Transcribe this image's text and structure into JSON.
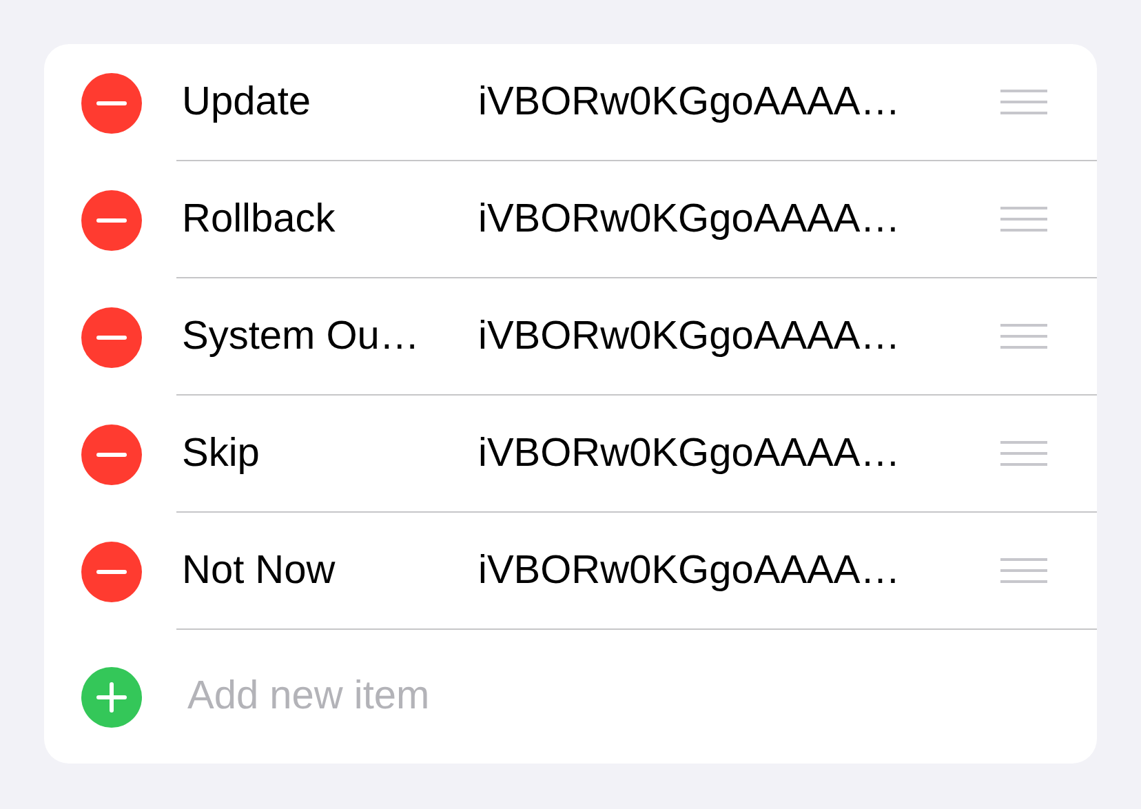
{
  "items": [
    {
      "label": "Update",
      "value": "iVBORw0KGgoAAAA…"
    },
    {
      "label": "Rollback",
      "value": "iVBORw0KGgoAAAA…"
    },
    {
      "label": "System Ou…",
      "value": "iVBORw0KGgoAAAA…"
    },
    {
      "label": "Skip",
      "value": "iVBORw0KGgoAAAA…"
    },
    {
      "label": "Not Now",
      "value": "iVBORw0KGgoAAAA…"
    }
  ],
  "add_item": {
    "placeholder": "Add new item"
  }
}
